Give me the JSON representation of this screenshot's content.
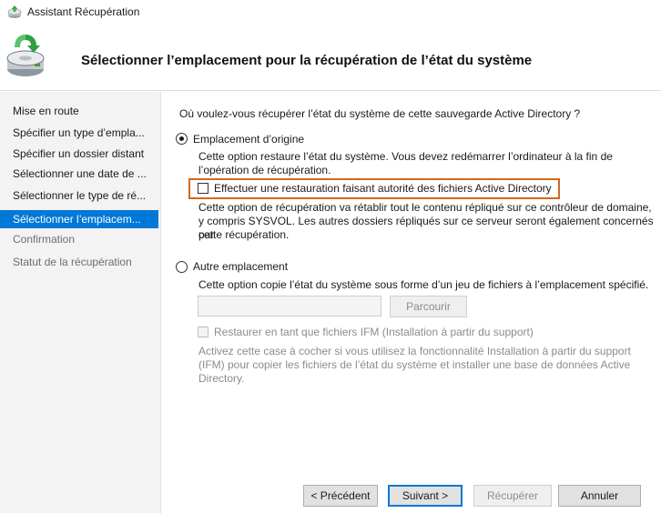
{
  "window": {
    "title": "Assistant Récupération",
    "icon": "backup-wizard-icon"
  },
  "header": {
    "title": "Sélectionner l’emplacement pour la récupération de l’état du système",
    "icon": "drive-restore-icon"
  },
  "nav": {
    "items": [
      {
        "label": "Mise en route",
        "state": "normal"
      },
      {
        "label": "Spécifier un type d’empla...",
        "state": "normal"
      },
      {
        "label": "Spécifier un dossier distant",
        "state": "normal"
      },
      {
        "label": "Sélectionner une date de ...",
        "state": "normal"
      },
      {
        "label": "Sélectionner le type de ré...",
        "state": "normal"
      },
      {
        "label": "Sélectionner l’emplacem...",
        "state": "selected"
      },
      {
        "label": "Confirmation",
        "state": "disabled"
      },
      {
        "label": "Statut de la récupération",
        "state": "disabled"
      }
    ]
  },
  "main": {
    "question": "Où voulez-vous récupérer l’état du système de cette sauvegarde Active Directory ?",
    "option_original": {
      "label": "Emplacement d’origine",
      "checked": true,
      "desc_line1": "Cette option restaure l’état du système. Vous devez redémarrer l’ordinateur à la fin de",
      "desc_line2": "l’opération de récupération.",
      "authoritative_checkbox": {
        "label": "Effectuer une restauration faisant autorité des fichiers Active Directory",
        "checked": false
      },
      "auth_desc_line1": "Cette option de récupération va rétablir tout le contenu répliqué sur ce contrôleur de domaine,",
      "auth_desc_line2": "y compris SYSVOL. Les autres dossiers répliqués sur ce serveur seront également concernés par",
      "auth_desc_line3": "cette récupération."
    },
    "option_other": {
      "label": "Autre emplacement",
      "checked": false,
      "desc": "Cette option copie l’état du système sous forme d’un jeu de fichiers à l’emplacement spécifié.",
      "path_value": "",
      "browse_label": "Parcourir",
      "ifm_checkbox": {
        "label": "Restaurer en tant que fichiers IFM (Installation à partir du support)",
        "checked": false
      },
      "ifm_desc_line1": "Activez cette case à cocher si vous utilisez la fonctionnalité Installation à partir du support",
      "ifm_desc_line2": "(IFM) pour copier les fichiers de l’état du système et installer une base de données Active",
      "ifm_desc_line3": "Directory."
    }
  },
  "footer": {
    "previous": "< Précédent",
    "next": "Suivant >",
    "recover": "Récupérer",
    "cancel": "Annuler"
  },
  "colors": {
    "accent": "#0078d7",
    "highlight_box": "#d2691e",
    "nav_background": "#f3f3f3"
  }
}
